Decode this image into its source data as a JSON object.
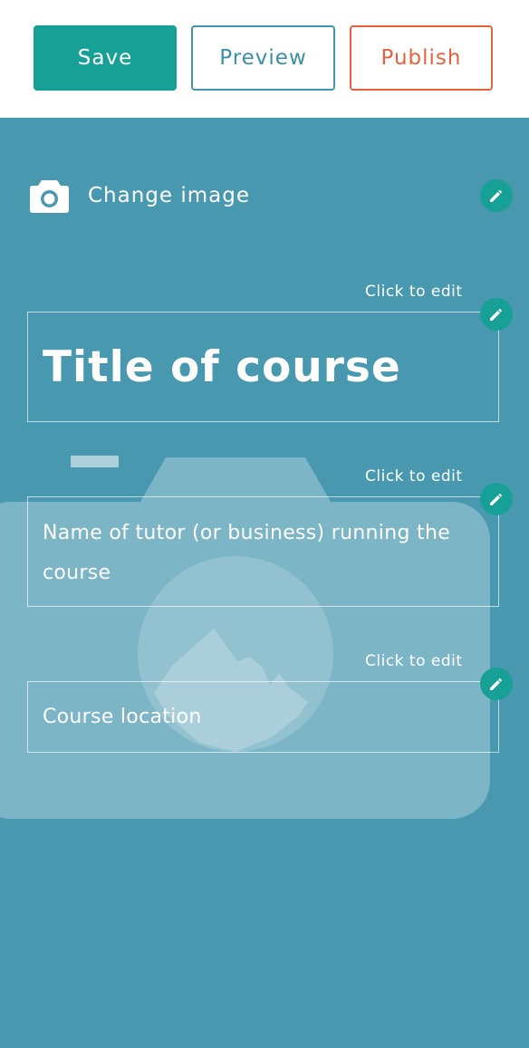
{
  "toolbar": {
    "save_label": "Save",
    "preview_label": "Preview",
    "publish_label": "Publish"
  },
  "hero": {
    "change_image_label": "Change image",
    "title": {
      "hint": "Click to edit",
      "value": "Title of course"
    },
    "tutor": {
      "hint": "Click to edit",
      "value": "Name of tutor (or business) running the course"
    },
    "location": {
      "hint": "Click to edit",
      "value": "Course location"
    }
  },
  "colors": {
    "accent": "#17a096",
    "hero_background": "#4899b0",
    "preview_outline": "#3f95ad",
    "publish_outline": "#e5623c"
  },
  "icons": {
    "change_image": "camera-icon",
    "edit": "pencil-icon",
    "placeholder": "image-placeholder-icon"
  }
}
